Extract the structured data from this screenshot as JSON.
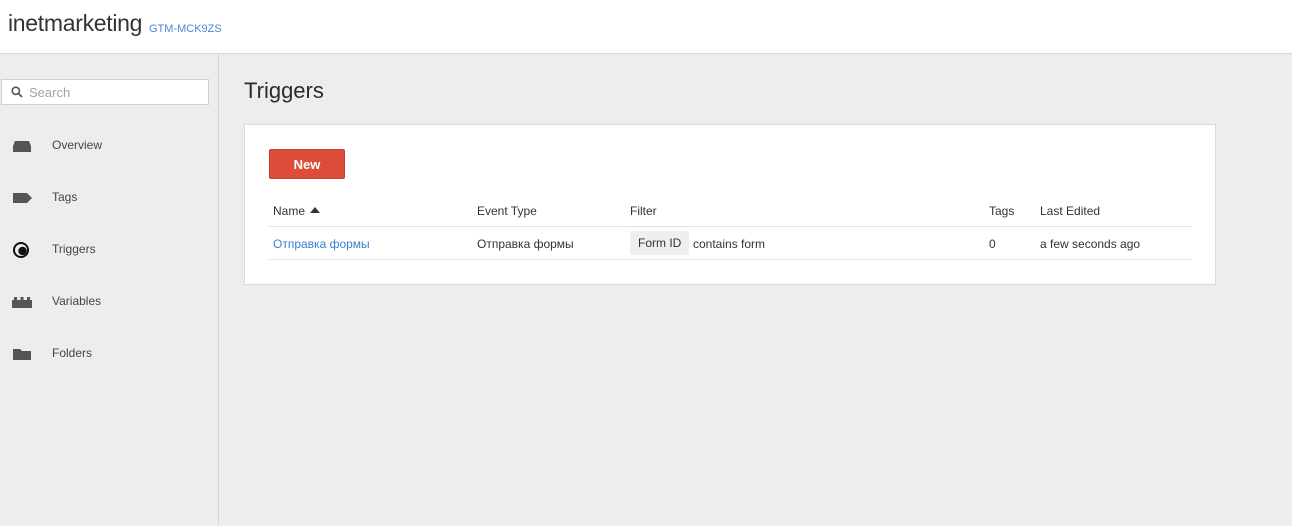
{
  "header": {
    "account_name": "inetmarketing",
    "container_id": "GTM-MCK9ZS"
  },
  "sidebar": {
    "search_placeholder": "Search",
    "items": [
      {
        "label": "Overview",
        "icon": "overview-icon"
      },
      {
        "label": "Tags",
        "icon": "tag-icon"
      },
      {
        "label": "Triggers",
        "icon": "trigger-icon",
        "active": true
      },
      {
        "label": "Variables",
        "icon": "variables-icon"
      },
      {
        "label": "Folders",
        "icon": "folder-icon"
      }
    ]
  },
  "main": {
    "title": "Triggers",
    "new_button_label": "New",
    "table": {
      "columns": [
        "Name",
        "Event Type",
        "Filter",
        "Tags",
        "Last Edited"
      ],
      "sort_column": "Name",
      "sort_direction": "ascending",
      "rows": [
        {
          "name": "Отправка формы",
          "event_type": "Отправка формы",
          "filter_variable": "Form ID",
          "filter_condition": "contains form",
          "tags": "0",
          "last_edited": "a few seconds ago"
        }
      ]
    }
  },
  "colors": {
    "accent_red": "#dd4b39",
    "link_blue": "#3f7ed0",
    "background": "#ededed"
  }
}
